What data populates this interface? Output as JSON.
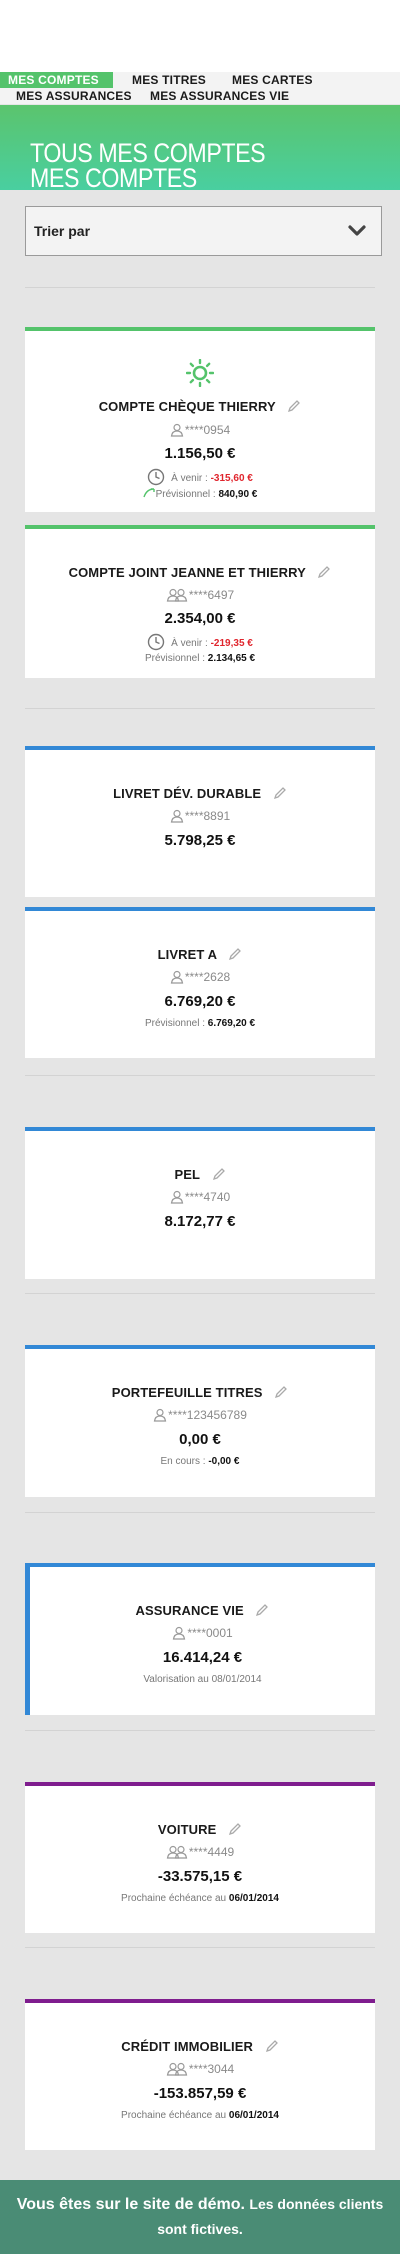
{
  "nav": {
    "items": [
      {
        "label": "MES COMPTES",
        "active": true
      },
      {
        "label": "MES TITRES",
        "active": false
      },
      {
        "label": "MES CARTES",
        "active": false
      },
      {
        "label": "MES ASSURANCES",
        "active": false
      },
      {
        "label": "MES ASSURANCES VIE",
        "active": false
      }
    ]
  },
  "banner": {
    "title_line1": "TOUS MES COMPTES",
    "title_line2": "MES COMPTES"
  },
  "sort": {
    "label": "Trier par",
    "icon": "chevron-down-icon"
  },
  "accounts": [
    {
      "name": "COMPTE CHÈQUE THIERRY",
      "number": "****0954",
      "holder_icon": "single-user-icon",
      "status_icon": "sun-icon",
      "balance": "1.156,50 €",
      "pending_label": "À venir :",
      "pending_value": "-315,60 €",
      "forecast_label": "Prévisionnel :",
      "forecast_value": "840,90 €",
      "accent": "#54c36b"
    },
    {
      "name": "COMPTE JOINT JEANNE ET THIERRY",
      "number": "****6497",
      "holder_icon": "two-users-icon",
      "balance": "2.354,00 €",
      "pending_label": "À venir :",
      "pending_value": "-219,35 €",
      "forecast_label": "Prévisionnel :",
      "forecast_value": "2.134,65 €",
      "accent": "#54c36b"
    },
    {
      "name": "LIVRET DÉV. DURABLE",
      "number": "****8891",
      "holder_icon": "single-user-icon",
      "balance": "5.798,25 €",
      "accent": "#3288d6"
    },
    {
      "name": "LIVRET A",
      "number": "****2628",
      "holder_icon": "single-user-icon",
      "balance": "6.769,20 €",
      "forecast_label": "Prévisionnel :",
      "forecast_value": "6.769,20 €",
      "accent": "#3288d6"
    },
    {
      "name": "PEL",
      "number": "****4740",
      "holder_icon": "single-user-icon",
      "balance": "8.172,77 €",
      "accent": "#3288d6"
    },
    {
      "name": "PORTEFEUILLE TITRES",
      "number": "****123456789",
      "holder_icon": "single-user-icon",
      "balance": "0,00 €",
      "ongoing_label": "En cours :",
      "ongoing_value": "-0,00 €",
      "accent": "#3288d6"
    },
    {
      "name": "ASSURANCE VIE",
      "number": "****0001",
      "holder_icon": "single-user-icon",
      "balance": "16.414,24 €",
      "valuation_text": "Valorisation au 08/01/2014",
      "accent": "#3288d6"
    },
    {
      "name": "VOITURE",
      "number": "****4449",
      "holder_icon": "two-users-icon",
      "balance": "-33.575,15 €",
      "due_label": "Prochaine échéance au",
      "due_value": "06/01/2014",
      "accent": "#7f1d8e"
    },
    {
      "name": "CRÉDIT IMMOBILIER",
      "number": "****3044",
      "holder_icon": "two-users-icon",
      "balance": "-153.857,59 €",
      "due_label": "Prochaine échéance au",
      "due_value": "06/01/2014",
      "accent": "#7f1d8e"
    }
  ],
  "footer": {
    "text_large": "Vous êtes sur le site de démo.",
    "text_small": "Les données clients sont fictives."
  },
  "colors": {
    "green": "#54c36b",
    "blue": "#3288d6",
    "purple": "#7f1d8e",
    "negative": "#e0252d",
    "footer_bg": "#4a8c75"
  }
}
